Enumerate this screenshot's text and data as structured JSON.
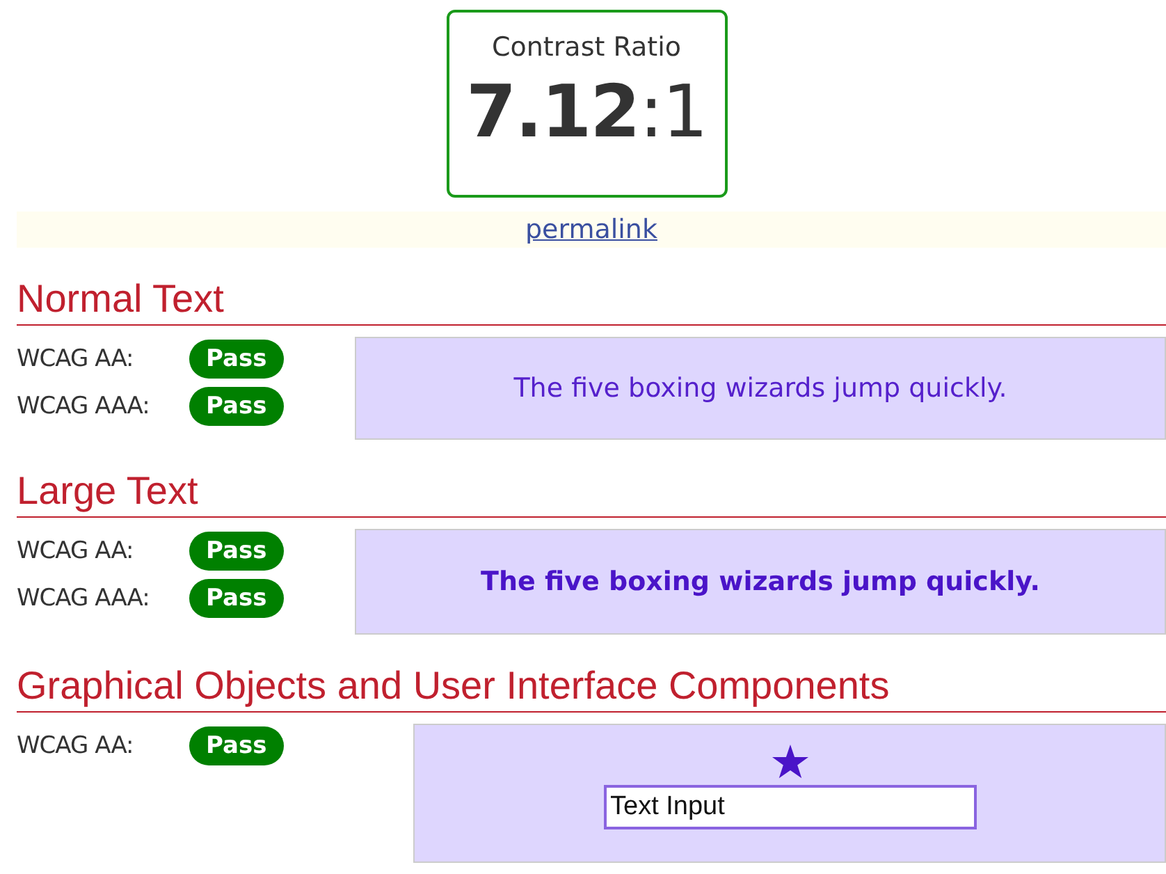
{
  "ratio": {
    "label": "Contrast Ratio",
    "value": "7.12",
    "suffix": ":1"
  },
  "permalink": "permalink",
  "sections": [
    {
      "kind": "normal",
      "title": "Normal Text",
      "results": [
        {
          "label": "WCAG AA:",
          "result": "Pass"
        },
        {
          "label": "WCAG AAA:",
          "result": "Pass"
        }
      ],
      "sample": "The five boxing wizards jump quickly."
    },
    {
      "kind": "large",
      "title": "Large Text",
      "results": [
        {
          "label": "WCAG AA:",
          "result": "Pass"
        },
        {
          "label": "WCAG AAA:",
          "result": "Pass"
        }
      ],
      "sample": "The five boxing wizards jump quickly."
    },
    {
      "kind": "graphical",
      "title": "Graphical Objects and User Interface Components",
      "results": [
        {
          "label": "WCAG AA:",
          "result": "Pass"
        }
      ],
      "input_value": "Text Input"
    }
  ]
}
